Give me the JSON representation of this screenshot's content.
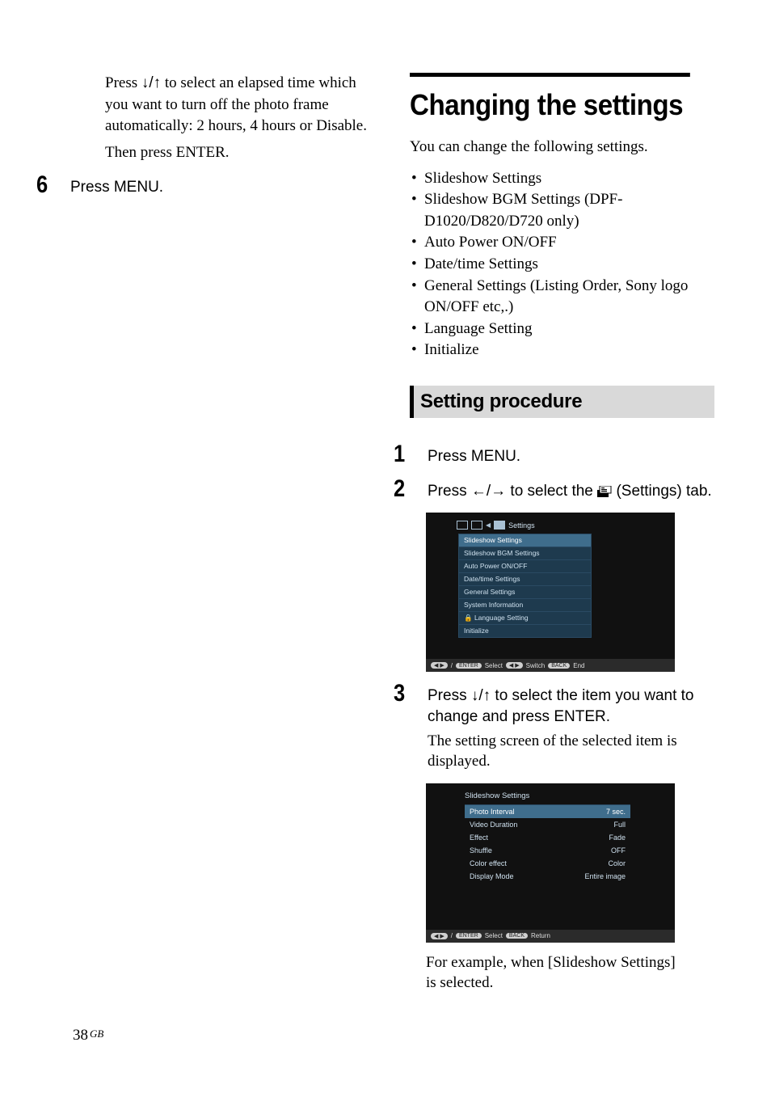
{
  "left": {
    "para1_pre": "Press ",
    "para1_arrows": "↓/↑",
    "para1_post": " to select an elapsed time which you want to turn off the photo frame automatically: 2 hours, 4 hours or Disable.",
    "para2": "Then press ENTER.",
    "step6": {
      "num": "6",
      "text": "Press MENU."
    }
  },
  "right": {
    "title": "Changing the settings",
    "intro": "You can change the following settings.",
    "bullets": [
      "Slideshow Settings",
      "Slideshow BGM Settings (DPF-D1020/D820/D720 only)",
      "Auto Power ON/OFF",
      "Date/time Settings",
      "General Settings (Listing Order, Sony logo ON/OFF etc,.)",
      "Language Setting",
      "Initialize"
    ],
    "subheading": "Setting procedure",
    "step1": {
      "num": "1",
      "text": "Press MENU."
    },
    "step2": {
      "num": "2",
      "pre": "Press ",
      "arrows": "←/→",
      "mid": " to select the ",
      "post": " (Settings) tab."
    },
    "screenshot1": {
      "tab_label": "Settings",
      "menu_items": [
        "Slideshow Settings",
        "Slideshow BGM Settings",
        "Auto Power ON/OFF",
        "Date/time Settings",
        "General Settings",
        "System Information",
        "Language Setting",
        "Initialize"
      ],
      "footer": {
        "enter": "ENTER",
        "select": "Select",
        "switch": "Switch",
        "back": "BACK",
        "end": "End"
      }
    },
    "step3": {
      "num": "3",
      "pre": "Press ",
      "arrows": "↓/↑",
      "post": " to select the item you want to change and press ENTER.",
      "sub": "The setting screen of the selected item is displayed."
    },
    "screenshot2": {
      "title": "Slideshow Settings",
      "rows": [
        {
          "label": "Photo Interval",
          "value": "7 sec."
        },
        {
          "label": "Video Duration",
          "value": "Full"
        },
        {
          "label": "Effect",
          "value": "Fade"
        },
        {
          "label": "Shuffle",
          "value": "OFF"
        },
        {
          "label": "Color effect",
          "value": "Color"
        },
        {
          "label": "Display Mode",
          "value": "Entire image"
        }
      ],
      "footer": {
        "enter": "ENTER",
        "select": "Select",
        "back": "BACK",
        "return": "Return"
      }
    },
    "caption": "For example, when [Slideshow Settings] is selected."
  },
  "page_number": "38",
  "page_region": "GB"
}
